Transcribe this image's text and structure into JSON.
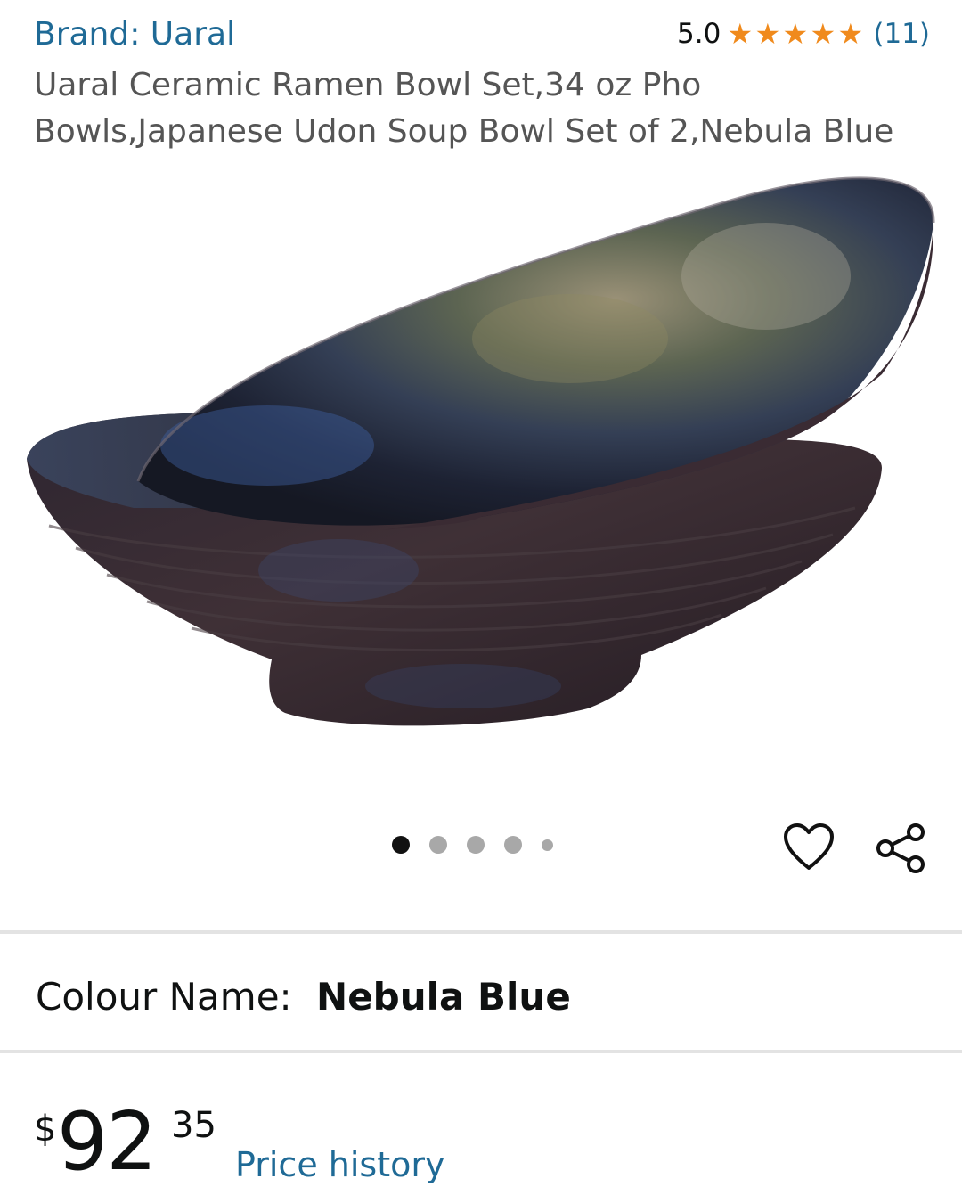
{
  "product": {
    "brand_label": "Brand: Uaral",
    "title": "Uaral Ceramic Ramen Bowl Set,34 oz Pho Bowls,Japanese Udon Soup Bowl Set of 2,Nebula Blue",
    "rating": {
      "value": "5.0",
      "stars": 5,
      "count": "(11)"
    }
  },
  "gallery": {
    "dot_count": 5,
    "active_index": 0
  },
  "actions": {
    "wishlist_icon": "heart-icon",
    "share_icon": "share-icon"
  },
  "variation": {
    "label": "Colour Name:",
    "value": "Nebula Blue"
  },
  "price": {
    "currency": "$",
    "whole": "92",
    "fraction": "35",
    "history_link": "Price history"
  },
  "colors": {
    "link": "#1f6a96",
    "star": "#f08a1c",
    "divider": "#e3e3e3"
  }
}
